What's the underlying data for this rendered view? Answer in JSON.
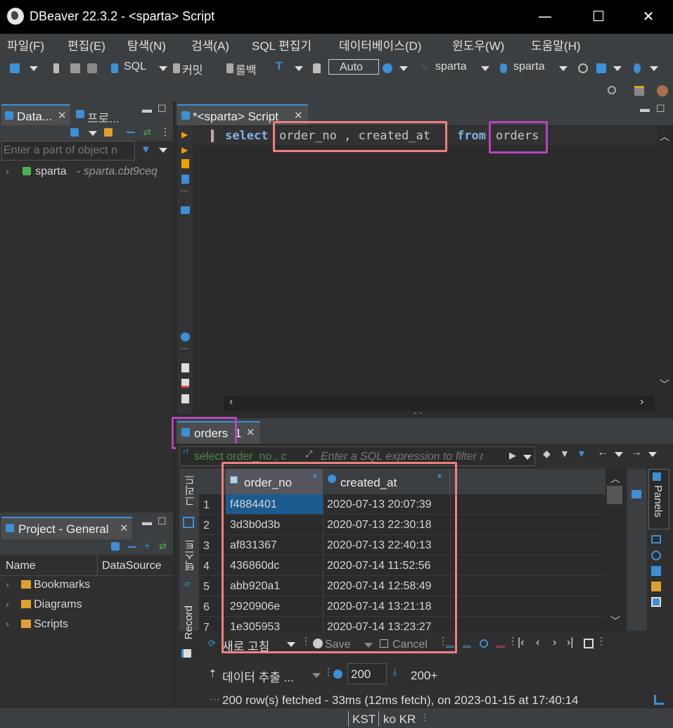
{
  "window": {
    "title": "DBeaver 22.3.2 - <sparta> Script",
    "minimize": "—",
    "maximize": "☐",
    "close": "✕"
  },
  "menu": [
    "파일(F)",
    "편집(E)",
    "탐색(N)",
    "검색(A)",
    "SQL 편집기",
    "데이터베이스(D)",
    "윈도우(W)",
    "도움말(H)"
  ],
  "toolbar": {
    "sql": "SQL",
    "commit": "커밋",
    "rollback": "롤백",
    "auto": "Auto",
    "datasource": "sparta",
    "schema": "sparta"
  },
  "db_navigator": {
    "tab_label": "Data...",
    "tab2_label": "프로...",
    "filter_placeholder": "Enter a part of object n",
    "connection_name": "sparta",
    "connection_host": "- sparta.cbt9ceq"
  },
  "project": {
    "tab_label": "Project - General",
    "col_name": "Name",
    "col_datasource": "DataSource",
    "items": [
      "Bookmarks",
      "Diagrams",
      "Scripts"
    ]
  },
  "editor": {
    "tab_label": "*<sparta> Script",
    "sql": {
      "kw_select": "select",
      "columns": "order_no , created_at",
      "kw_from": "from",
      "table": "orders"
    }
  },
  "results": {
    "tab_label": "orders",
    "tab_count": "1",
    "query_echo": "select order_no , c",
    "filter_placeholder": "Enter a SQL expression to filter r",
    "side_tabs": [
      "그리드",
      "텍스트",
      "Record"
    ],
    "columns": [
      "order_no",
      "created_at"
    ],
    "rows": [
      {
        "n": "1",
        "order_no": "f4884401",
        "created_at": "2020-07-13 20:07:39"
      },
      {
        "n": "2",
        "order_no": "3d3b0d3b",
        "created_at": "2020-07-13 22:30:18"
      },
      {
        "n": "3",
        "order_no": "af831367",
        "created_at": "2020-07-13 22:40:13"
      },
      {
        "n": "4",
        "order_no": "436860dc",
        "created_at": "2020-07-14 11:52:56"
      },
      {
        "n": "5",
        "order_no": "abb920a1",
        "created_at": "2020-07-14 12:58:49"
      },
      {
        "n": "6",
        "order_no": "2920906e",
        "created_at": "2020-07-14 13:21:18"
      },
      {
        "n": "7",
        "order_no": "1e305953",
        "created_at": "2020-07-14 13:23:27"
      }
    ],
    "refresh": "새로 고침",
    "save": "Save",
    "cancel": "Cancel",
    "export": "데이터 추출 ...",
    "fetch_size": "200",
    "fetch_more": "200+",
    "status": "200 row(s) fetched - 33ms (12ms fetch), on 2023-01-15 at 17:40:14",
    "panels": "Panels"
  },
  "statusbar": {
    "tz": "KST",
    "locale": "ko KR"
  },
  "colors": {
    "highlight_pink": "#f08080",
    "highlight_purple": "#b445b8",
    "keyword": "#7fb4e9",
    "selected_cell": "#1c5a8e"
  }
}
